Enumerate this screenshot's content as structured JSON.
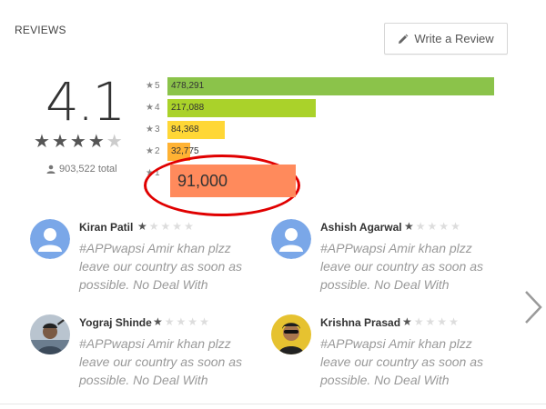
{
  "header": {
    "title": "REVIEWS",
    "write_review_label": "Write a Review"
  },
  "rating": {
    "score": "4.1",
    "stars_filled": 4,
    "stars_total": 5,
    "total_count": "903,522 total"
  },
  "histogram": [
    {
      "stars": "5",
      "count": "478,291",
      "value": 478291,
      "color": "#8bc34a"
    },
    {
      "stars": "4",
      "count": "217,088",
      "value": 217088,
      "color": "#aad22a"
    },
    {
      "stars": "3",
      "count": "84,368",
      "value": 84368,
      "color": "#ffd736"
    },
    {
      "stars": "2",
      "count": "32,775",
      "value": 32775,
      "color": "#ffb233"
    },
    {
      "stars": "1",
      "count": "91,000",
      "value": 91000,
      "color": "#ff8a5c"
    }
  ],
  "reviews": [
    {
      "name": "Kiran Patil",
      "rating": 1,
      "text": "#APPwapsi Amir khan plzz leave our country as soon as possible. No Deal With"
    },
    {
      "name": "Ashish Agarwal",
      "rating": 1,
      "text": "#APPwapsi Amir khan plzz leave our country as soon as possible. No Deal With"
    },
    {
      "name": "Yograj Shinde",
      "rating": 1,
      "text": "#APPwapsi Amir khan plzz leave our country as soon as possible. No Deal With"
    },
    {
      "name": "Krishna Prasad",
      "rating": 1,
      "text": "#APPwapsi Amir khan plzz leave our country as soon as possible. No Deal With"
    }
  ],
  "colors": {
    "annotation_ring": "#e00000",
    "avatar_default_bg": "#7aa7e8"
  }
}
